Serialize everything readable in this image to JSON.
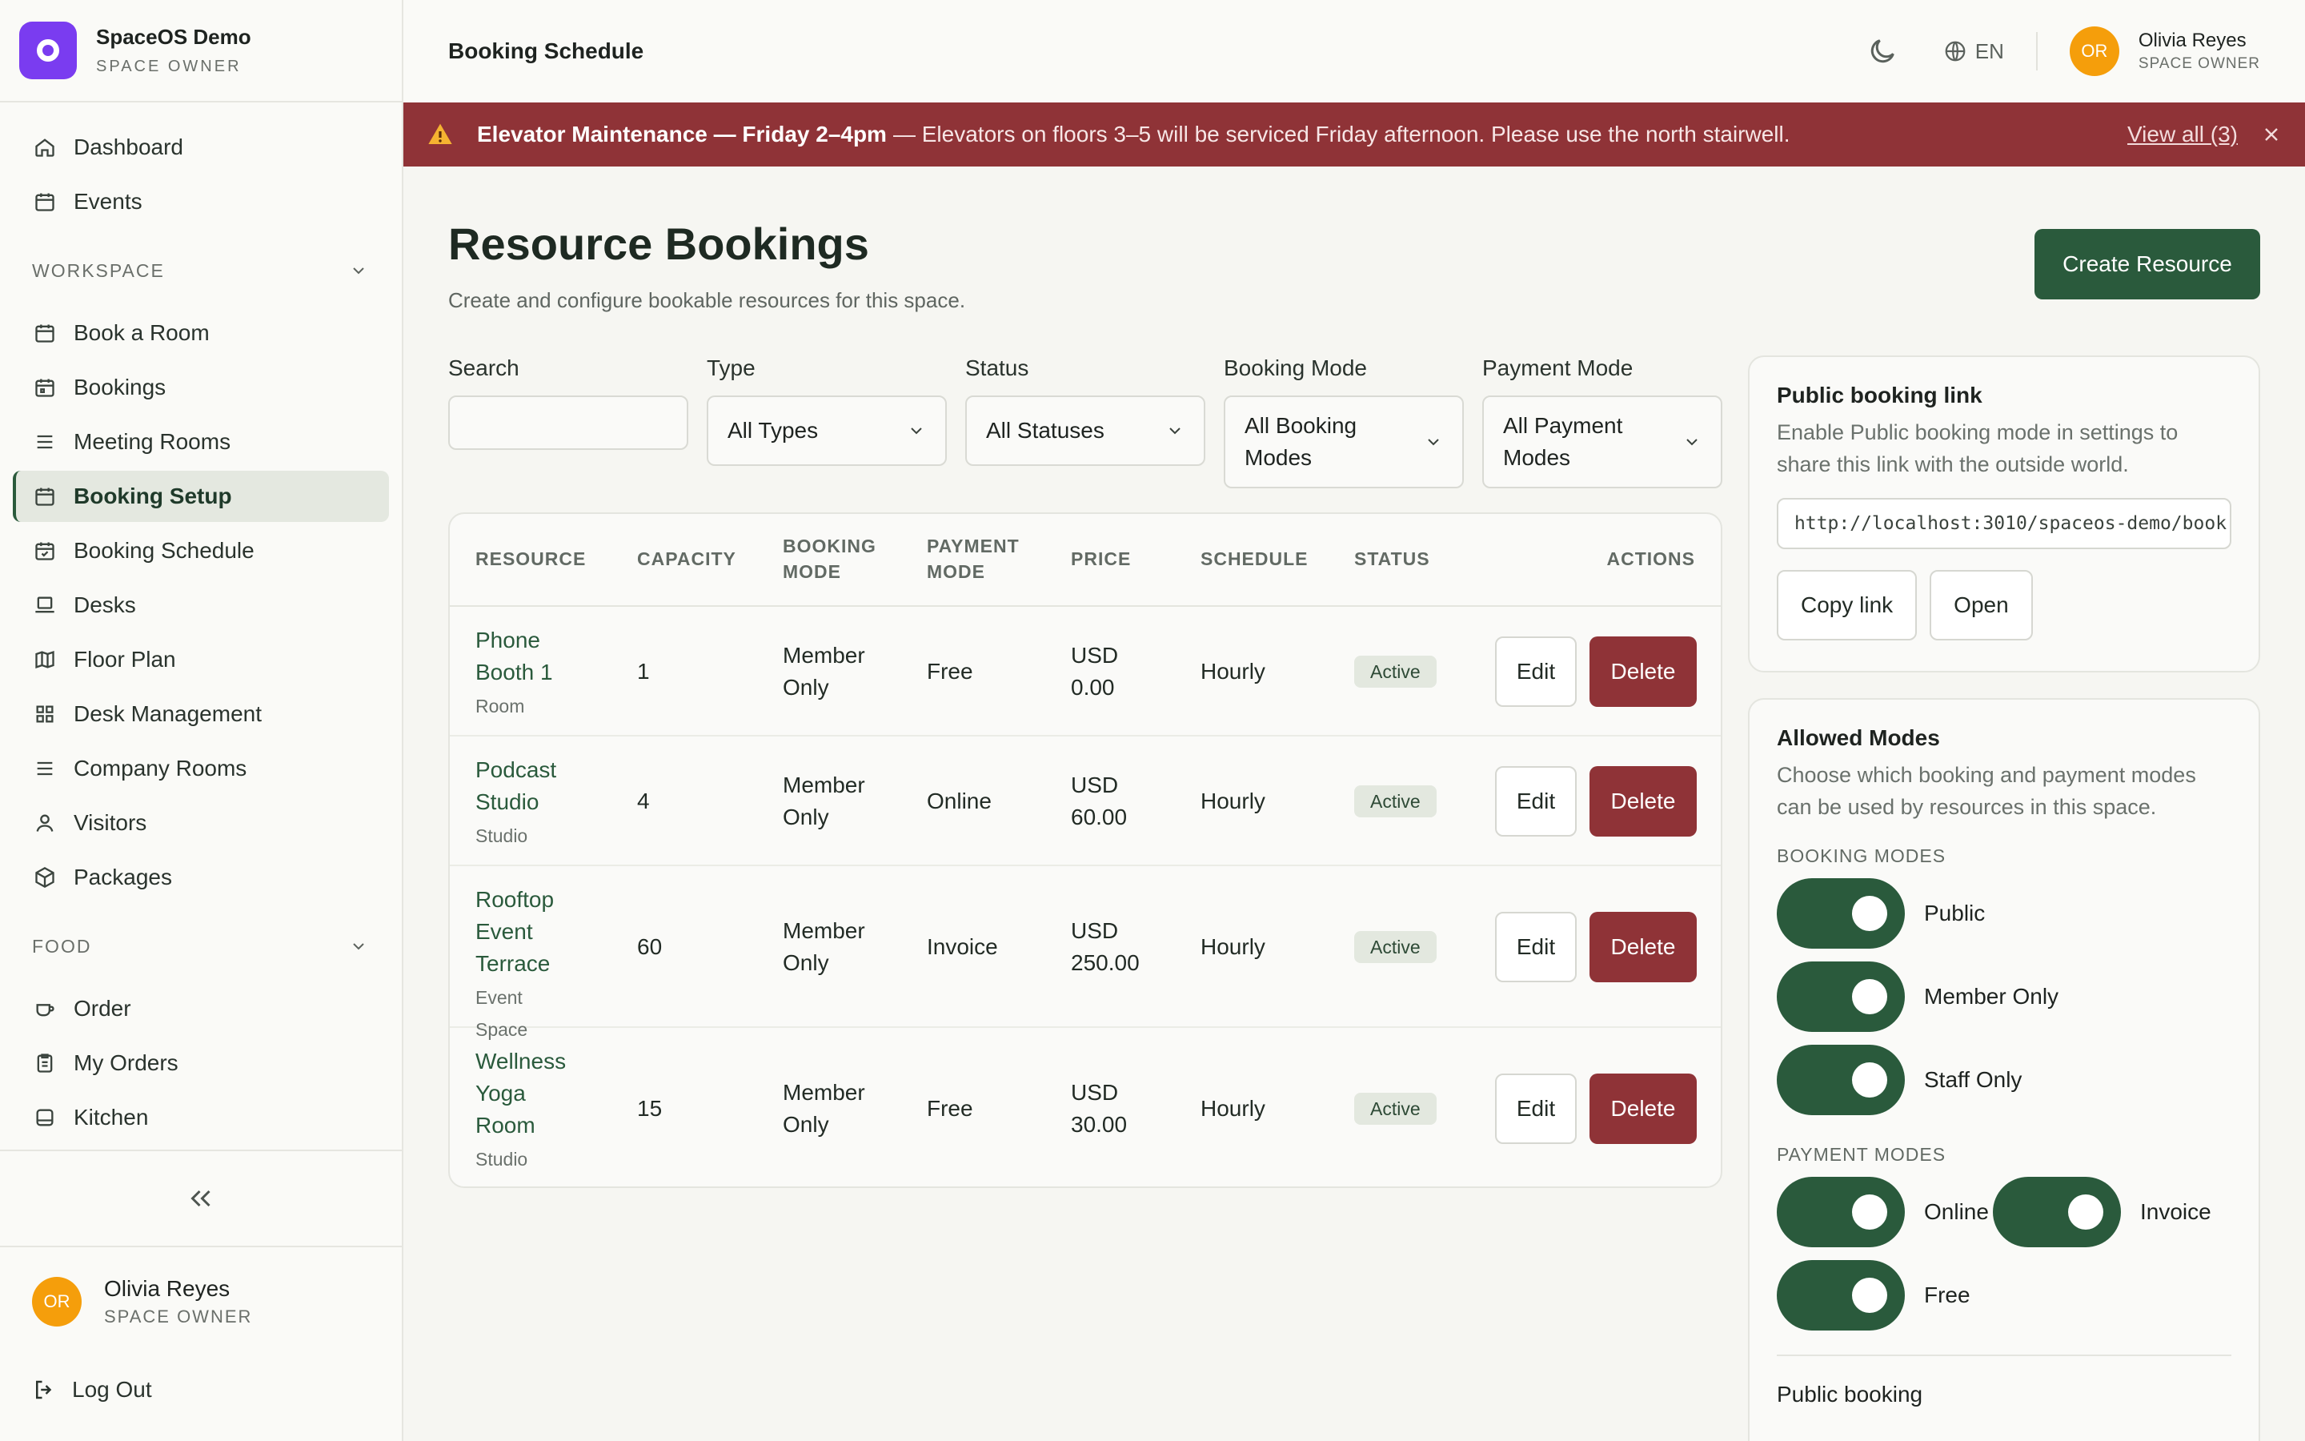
{
  "brand": {
    "name": "SpaceOS Demo",
    "role": "SPACE OWNER"
  },
  "nav_top": [
    {
      "label": "Dashboard",
      "icon": "home-icon"
    },
    {
      "label": "Events",
      "icon": "calendar-icon"
    }
  ],
  "workspace": {
    "title": "WORKSPACE",
    "items": [
      {
        "label": "Book a Room",
        "icon": "calendar-icon"
      },
      {
        "label": "Bookings",
        "icon": "calendar-icon"
      },
      {
        "label": "Meeting Rooms",
        "icon": "list-icon"
      },
      {
        "label": "Booking Setup",
        "icon": "calendar-icon",
        "active": true
      },
      {
        "label": "Booking Schedule",
        "icon": "calendar-check-icon"
      },
      {
        "label": "Desks",
        "icon": "laptop-icon"
      },
      {
        "label": "Floor Plan",
        "icon": "map-icon"
      },
      {
        "label": "Desk Management",
        "icon": "grid-icon"
      },
      {
        "label": "Company Rooms",
        "icon": "list-icon"
      },
      {
        "label": "Visitors",
        "icon": "user-icon"
      },
      {
        "label": "Packages",
        "icon": "package-icon"
      }
    ]
  },
  "food": {
    "title": "FOOD",
    "items": [
      {
        "label": "Order",
        "icon": "cup-icon"
      },
      {
        "label": "My Orders",
        "icon": "clipboard-icon"
      },
      {
        "label": "Kitchen",
        "icon": "kitchen-icon"
      }
    ]
  },
  "sidebar_user": {
    "initials": "OR",
    "name": "Olivia Reyes",
    "role": "SPACE OWNER"
  },
  "logout_label": "Log Out",
  "topbar": {
    "title": "Booking Schedule",
    "lang": "EN",
    "user": {
      "initials": "OR",
      "name": "Olivia Reyes",
      "role": "SPACE OWNER"
    }
  },
  "alert": {
    "title": "Elevator Maintenance — Friday 2–4pm",
    "body": "— Elevators on floors 3–5 will be serviced Friday afternoon. Please use the north stairwell.",
    "link": "View all (3)"
  },
  "main": {
    "title": "Resource Bookings",
    "subtitle": "Create and configure bookable resources for this space.",
    "create_button": "Create Resource"
  },
  "filters": {
    "search": {
      "label": "Search",
      "value": ""
    },
    "type": {
      "label": "Type",
      "value": "All Types"
    },
    "status": {
      "label": "Status",
      "value": "All Statuses"
    },
    "booking_mode": {
      "label": "Booking Mode",
      "value": "All Booking Modes"
    },
    "payment_mode": {
      "label": "Payment Mode",
      "value": "All Payment Modes"
    }
  },
  "table": {
    "headers": {
      "resource": "RESOURCE",
      "capacity": "CAPACITY",
      "booking_mode": "BOOKING MODE",
      "payment_mode": "PAYMENT MODE",
      "price": "PRICE",
      "schedule": "SCHEDULE",
      "status": "STATUS",
      "actions": "ACTIONS"
    },
    "rows": [
      {
        "name": "Phone Booth 1",
        "type": "Room",
        "capacity": "1",
        "booking_mode": "Member Only",
        "payment_mode": "Free",
        "price": "USD 0.00",
        "schedule": "Hourly",
        "status": "Active",
        "edit": "Edit",
        "delete": "Delete"
      },
      {
        "name": "Podcast Studio",
        "type": "Studio",
        "capacity": "4",
        "booking_mode": "Member Only",
        "payment_mode": "Online",
        "price": "USD 60.00",
        "schedule": "Hourly",
        "status": "Active",
        "edit": "Edit",
        "delete": "Delete"
      },
      {
        "name": "Rooftop Event Terrace",
        "type": "Event Space",
        "capacity": "60",
        "booking_mode": "Member Only",
        "payment_mode": "Invoice",
        "price": "USD 250.00",
        "schedule": "Hourly",
        "status": "Active",
        "edit": "Edit",
        "delete": "Delete"
      },
      {
        "name": "Wellness Yoga Room",
        "type": "Studio",
        "capacity": "15",
        "booking_mode": "Member Only",
        "payment_mode": "Free",
        "price": "USD 30.00",
        "schedule": "Hourly",
        "status": "Active",
        "edit": "Edit",
        "delete": "Delete"
      }
    ]
  },
  "public_link": {
    "title": "Public booking link",
    "description": "Enable Public booking mode in settings to share this link with the outside world.",
    "url": "http://localhost:3010/spaceos-demo/book",
    "copy_label": "Copy link",
    "open_label": "Open"
  },
  "allowed_modes": {
    "title": "Allowed Modes",
    "description": "Choose which booking and payment modes can be used by resources in this space.",
    "booking_label": "BOOKING MODES",
    "booking_modes": [
      {
        "label": "Public",
        "enabled": true
      },
      {
        "label": "Member Only",
        "enabled": true
      },
      {
        "label": "Staff Only",
        "enabled": true
      }
    ],
    "payment_label": "PAYMENT MODES",
    "payment_modes": [
      {
        "label": "Online",
        "enabled": true
      },
      {
        "label": "Invoice",
        "enabled": true
      },
      {
        "label": "Free",
        "enabled": true
      }
    ],
    "footer_label": "Public booking"
  },
  "colors": {
    "accent": "#2a5a3c",
    "danger": "#8f3337",
    "avatar": "#f59e0b",
    "brand": "#7a3cf0"
  }
}
